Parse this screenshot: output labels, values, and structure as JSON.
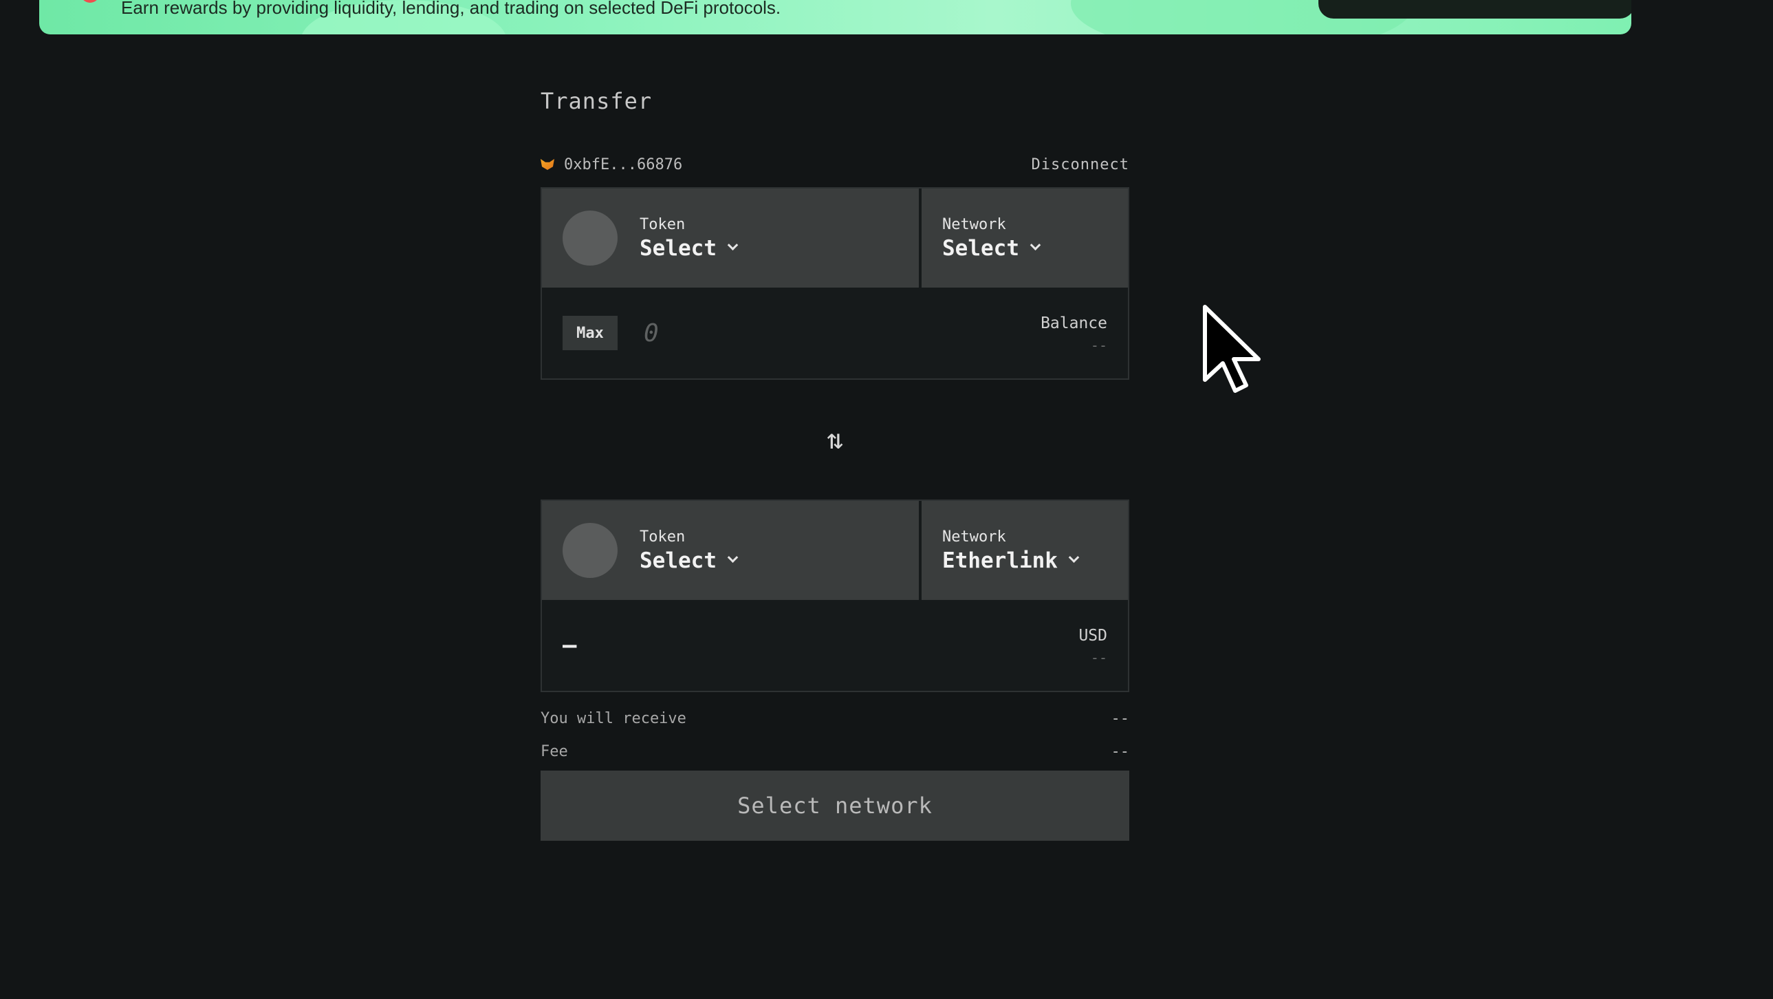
{
  "banner": {
    "text": "Earn rewards by providing liquidity, lending, and trading on selected DeFi protocols."
  },
  "transfer": {
    "title": "Transfer",
    "wallet": {
      "address": "0xbfE...66876",
      "icon": "metamask-fox-icon",
      "disconnect_label": "Disconnect"
    },
    "from": {
      "token_label": "Token",
      "token_value": "Select",
      "network_label": "Network",
      "network_value": "Select",
      "max_label": "Max",
      "amount_placeholder": "0",
      "balance_label": "Balance",
      "balance_value": "--"
    },
    "swap_icon": "⇅",
    "to": {
      "token_label": "Token",
      "token_value": "Select",
      "network_label": "Network",
      "network_value": "Etherlink",
      "amount_value": "–",
      "usd_label": "USD",
      "usd_value": "--"
    },
    "summary": {
      "receive_label": "You will receive",
      "receive_value": "--",
      "fee_label": "Fee",
      "fee_value": "--"
    },
    "action_label": "Select network"
  },
  "colors": {
    "background": "#121516",
    "banner_accent": "#8cf3bd",
    "cell_bg": "#3a3d3d",
    "button_bg": "#383b3b"
  }
}
